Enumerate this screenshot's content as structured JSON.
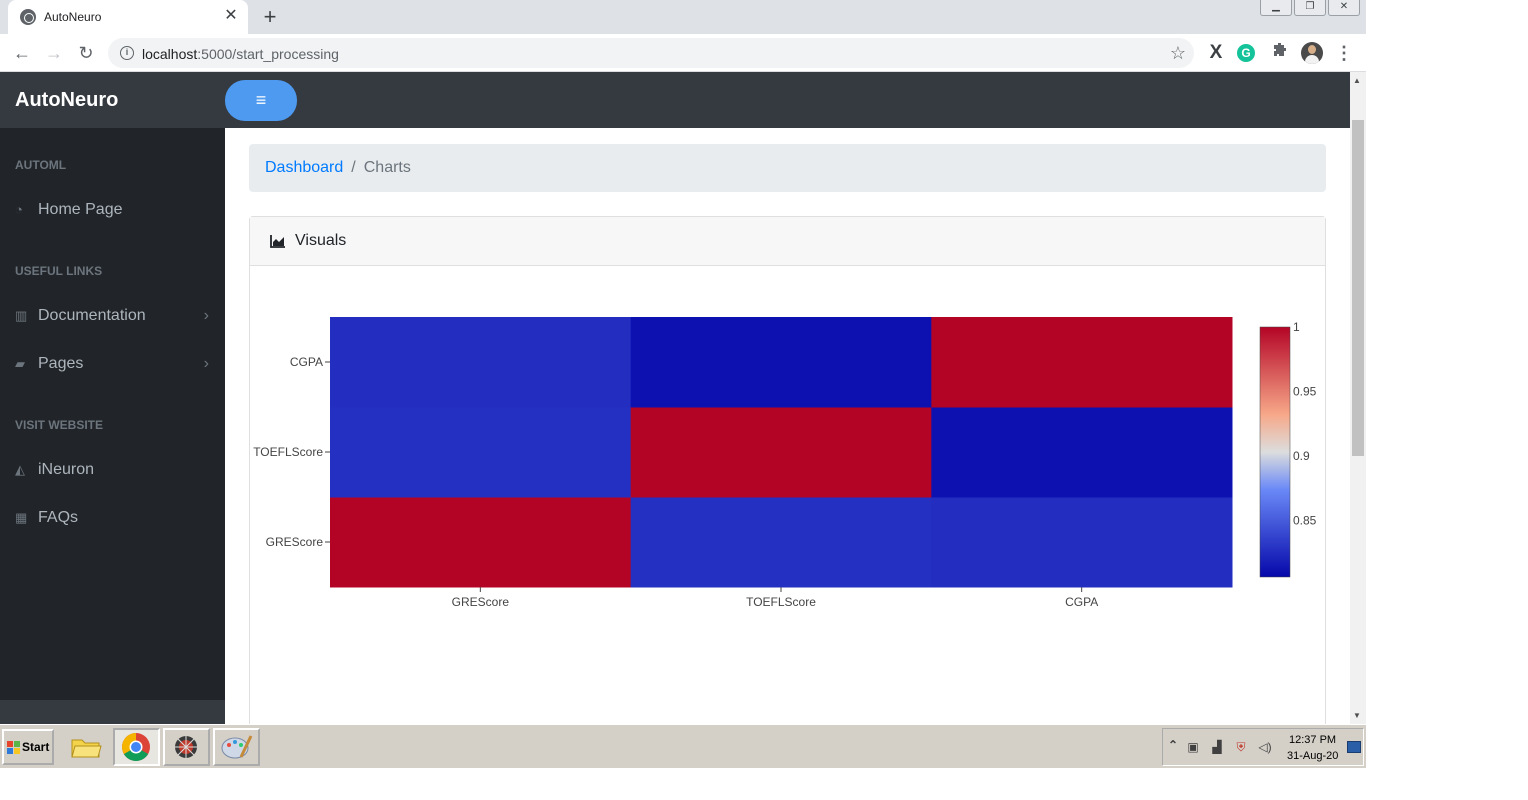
{
  "browser": {
    "tab_title": "AutoNeuro",
    "tab_close": "✕",
    "new_tab": "+",
    "url_host": "localhost",
    "url_path": ":5000/start_processing",
    "win_minimize": "▁",
    "win_restore": "❐",
    "win_close": "✕",
    "extensions": {
      "x": "X",
      "grammarly": "G"
    }
  },
  "navbar": {
    "brand": "AutoNeuro",
    "toggle_icon": "≡"
  },
  "sidebar": {
    "sections": [
      {
        "heading": "AUTOML",
        "items": [
          {
            "label": "Home Page",
            "icon": "tachometer-icon",
            "glyph": "◔"
          }
        ]
      },
      {
        "heading": "USEFUL LINKS",
        "items": [
          {
            "label": "Documentation",
            "icon": "columns-icon",
            "glyph": "▥",
            "chevron": "›"
          },
          {
            "label": "Pages",
            "icon": "book-icon",
            "glyph": "▰",
            "chevron": "›"
          }
        ]
      },
      {
        "heading": "VISIT WEBSITE",
        "items": [
          {
            "label": "iNeuron",
            "icon": "area-chart-icon",
            "glyph": "◭"
          },
          {
            "label": "FAQs",
            "icon": "table-icon",
            "glyph": "▦"
          }
        ]
      }
    ]
  },
  "breadcrumb": {
    "link": "Dashboard",
    "separator": "/",
    "active": "Charts"
  },
  "card": {
    "title": "Visuals"
  },
  "chart_data": {
    "type": "heatmap",
    "x_categories": [
      "GREScore",
      "TOEFLScore",
      "CGPA"
    ],
    "y_categories": [
      "GREScore",
      "TOEFLScore",
      "CGPA"
    ],
    "z": [
      [
        1.0,
        0.827,
        0.826
      ],
      [
        0.827,
        1.0,
        0.811
      ],
      [
        0.826,
        0.811,
        1.0
      ]
    ],
    "colorscale": [
      [
        0.0,
        "#0508aa"
      ],
      [
        0.35,
        "#6a89f7"
      ],
      [
        0.5,
        "#dcdddd"
      ],
      [
        0.65,
        "#f7a889"
      ],
      [
        1.0,
        "#b40426"
      ]
    ],
    "zmin": 0.806,
    "zmax": 1.0,
    "colorbar_ticks": [
      {
        "value": 1,
        "label": "1"
      },
      {
        "value": 0.95,
        "label": "0.95"
      },
      {
        "value": 0.9,
        "label": "0.9"
      },
      {
        "value": 0.85,
        "label": "0.85"
      }
    ]
  },
  "taskbar": {
    "start_label": "Start",
    "clock_time": "12:37 PM",
    "clock_date": "31-Aug-20",
    "tray_expand": "⌃"
  }
}
